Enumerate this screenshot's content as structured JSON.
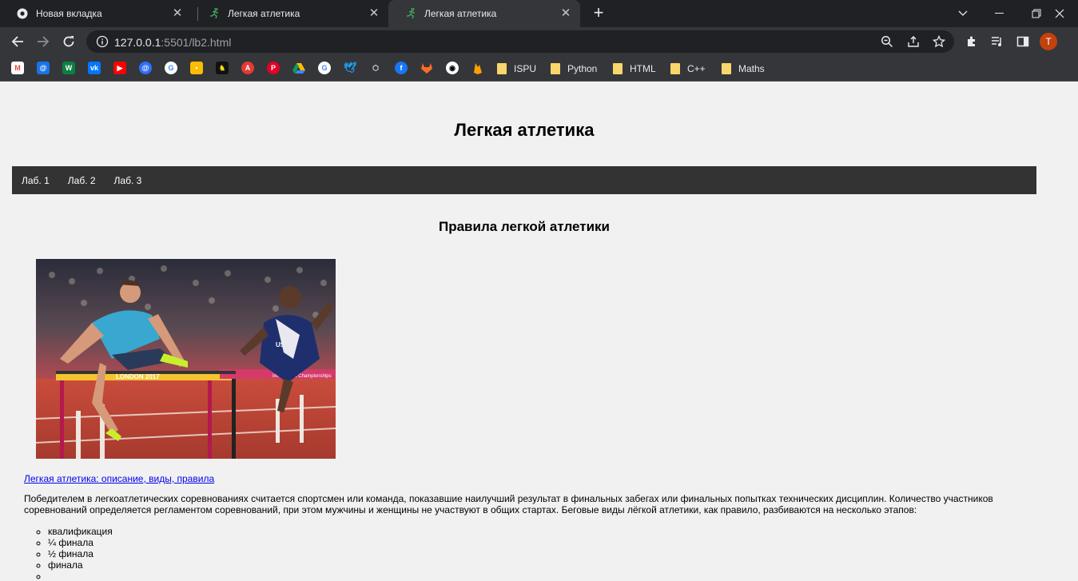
{
  "browser": {
    "tabs": [
      {
        "title": "Новая вкладка",
        "favicon": "chrome-icon"
      },
      {
        "title": "Легкая атлетика",
        "favicon": "runner-icon"
      },
      {
        "title": "Легкая атлетика",
        "favicon": "runner-icon",
        "active": true
      }
    ],
    "url_host": "127.0.0.1",
    "url_rest": ":5501/lb2.html",
    "avatar_letter": "T",
    "bookmark_icons": [
      "gmail",
      "mail",
      "w",
      "vk",
      "youtube",
      "messenger",
      "google",
      "keep",
      "app",
      "app2",
      "pinterest",
      "drive",
      "google",
      "twitter",
      "codepen",
      "facebook",
      "gitlab",
      "github",
      "firebase"
    ],
    "bookmark_folders": [
      "ISPU",
      "Python",
      "HTML",
      "C++",
      "Maths"
    ]
  },
  "site": {
    "title": "Легкая атлетика",
    "menu": [
      "Лаб. 1",
      "Лаб. 2",
      "Лаб. 3"
    ],
    "section_title": "Правила легкой атлетики",
    "photo_banner_left": "LONDON 2017",
    "photo_banner_right": "IAAF World Championships",
    "photo_bib": "USA",
    "link_text": "Легкая атлетика: описание, виды, правила",
    "paragraph": "Победителем в легкоатлетических соревнованиях считается спортсмен или команда, показавшие наилучший результат в финальных забегах или финальных попытках технических дисциплин. Количество участников соревнований определяется регламентом соревнований, при этом мужчины и женщины не участвуют в общих стартах. Беговые виды лёгкой атлетики, как правило, разбиваются на несколько этапов:",
    "stages": [
      "квалификация",
      "¼ финала",
      "½ финала",
      "финала",
      ""
    ]
  }
}
